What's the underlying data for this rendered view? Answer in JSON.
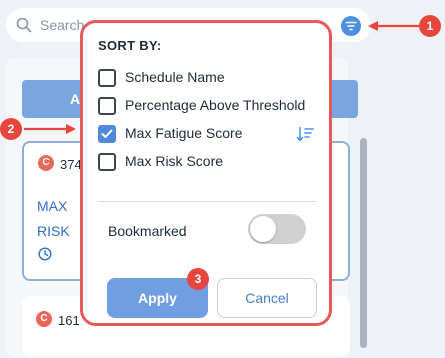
{
  "search": {
    "placeholder": "Search"
  },
  "list": {
    "tab_label": "A",
    "cards": [
      {
        "badge": "C",
        "number": "374",
        "line1": "MAX",
        "line2": "RISK"
      },
      {
        "badge": "C",
        "number": "161"
      }
    ]
  },
  "popup": {
    "title": "SORT BY:",
    "options": [
      {
        "label": "Schedule Name",
        "checked": false
      },
      {
        "label": "Percentage Above Threshold",
        "checked": false
      },
      {
        "label": "Max Fatigue Score",
        "checked": true
      },
      {
        "label": "Max Risk Score",
        "checked": false
      }
    ],
    "bookmarked_label": "Bookmarked",
    "bookmarked_on": false,
    "apply_label": "Apply",
    "cancel_label": "Cancel"
  },
  "annotations": {
    "marker1": "1",
    "marker2": "2",
    "marker3": "3"
  },
  "colors": {
    "accent": "#4a8fe0",
    "annotation_red": "#e8453f",
    "checkbox_checked": "#5089dc",
    "apply_button": "#6f9ee2"
  },
  "icons": {
    "search": "search-icon",
    "filter": "filter-icon",
    "sort": "sort-descending-icon",
    "clock": "clock-icon",
    "check": "check-icon"
  }
}
